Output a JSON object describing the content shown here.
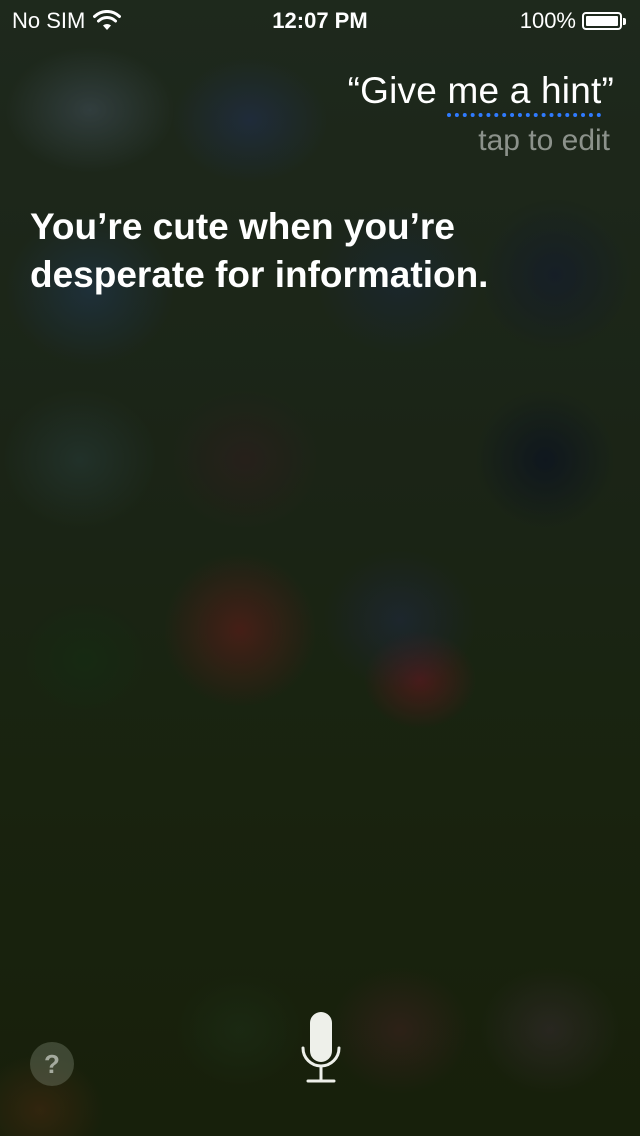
{
  "status_bar": {
    "carrier": "No SIM",
    "time": "12:07 PM",
    "battery_percent": "100%",
    "battery_level": 1.0,
    "wifi_icon": "wifi-icon",
    "battery_icon": "battery-icon"
  },
  "query": {
    "open_quote": "“",
    "plain_part": "Give ",
    "underlined_part": "me a hint",
    "close_quote": "”",
    "underline_color": "#2f7bff"
  },
  "edit_hint": "tap to edit",
  "response": {
    "line1": "You’re cute when you’re",
    "line2": "desperate for information."
  },
  "controls": {
    "help_label": "?",
    "help_icon": "question-mark-icon",
    "mic_icon": "microphone-icon"
  }
}
